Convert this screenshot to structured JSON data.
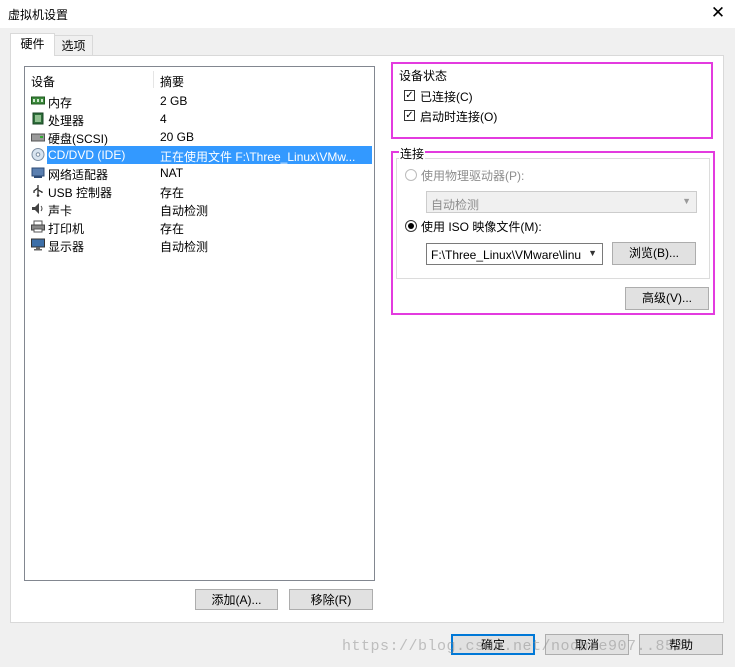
{
  "window": {
    "title": "虚拟机设置",
    "close_symbol": "✕"
  },
  "tabs": [
    {
      "label": "硬件"
    },
    {
      "label": "选项"
    }
  ],
  "device_list": {
    "headers": {
      "device": "设备",
      "summary": "摘要"
    },
    "rows": [
      {
        "name": "内存",
        "summary": "2 GB",
        "icon": "memory-icon"
      },
      {
        "name": "处理器",
        "summary": "4",
        "icon": "processor-icon"
      },
      {
        "name": "硬盘(SCSI)",
        "summary": "20 GB",
        "icon": "harddisk-icon"
      },
      {
        "name": "CD/DVD (IDE)",
        "summary": "正在使用文件 F:\\Three_Linux\\VMw...",
        "icon": "cd-dvd-icon",
        "selected": true
      },
      {
        "name": "网络适配器",
        "summary": "NAT",
        "icon": "network-adapter-icon"
      },
      {
        "name": "USB 控制器",
        "summary": "存在",
        "icon": "usb-icon"
      },
      {
        "name": "声卡",
        "summary": "自动检测",
        "icon": "sound-card-icon"
      },
      {
        "name": "打印机",
        "summary": "存在",
        "icon": "printer-icon"
      },
      {
        "name": "显示器",
        "summary": "自动检测",
        "icon": "display-icon"
      }
    ]
  },
  "buttons": {
    "add": "添加(A)...",
    "remove": "移除(R)",
    "ok": "确定",
    "cancel": "取消",
    "help": "帮助",
    "browse": "浏览(B)...",
    "advanced": "高级(V)..."
  },
  "device_status": {
    "title": "设备状态",
    "connected": {
      "label": "已连接(C)",
      "checked": true
    },
    "connect_at_power_on": {
      "label": "启动时连接(O)",
      "checked": true
    }
  },
  "connection": {
    "title": "连接",
    "physical_drive": {
      "label": "使用物理驱动器(P):",
      "selected": false,
      "enabled": false
    },
    "physical_drive_select": "自动检测",
    "iso_image": {
      "label": "使用 ISO 映像文件(M):",
      "selected": true
    },
    "iso_path": "F:\\Three_Linux\\VMware\\linu"
  },
  "watermark": "https://blog.csdn.net/noobie907..852",
  "colors": {
    "highlight": "#e33bdf",
    "selection": "#3399ff",
    "dialog_bg": "#f0f0f0"
  }
}
